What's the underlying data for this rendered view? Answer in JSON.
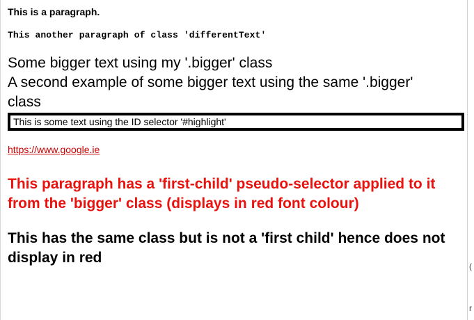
{
  "page": {
    "paragraph": "This is a paragraph.",
    "different_text": "This another paragraph of class 'differentText'",
    "bigger_1": "Some bigger text using my '.bigger' class",
    "bigger_2": "A second example of some bigger text using the same '.bigger' class",
    "highlight": "This is some text using the ID selector '#highlight'",
    "link": "https://www.google.ie",
    "first_child_para": "This paragraph has a 'first-child' pseudo-selector applied to it from the 'bigger' class (displays in red font colour)",
    "not_first_child_para": "This has the same class but is not a 'first child' hence does not display in red"
  },
  "colors": {
    "link": "#cc0000",
    "first_child": "#e8120e",
    "highlight_border": "#000000"
  },
  "edge": {
    "glyph_1": "(",
    "glyph_2": "r"
  }
}
